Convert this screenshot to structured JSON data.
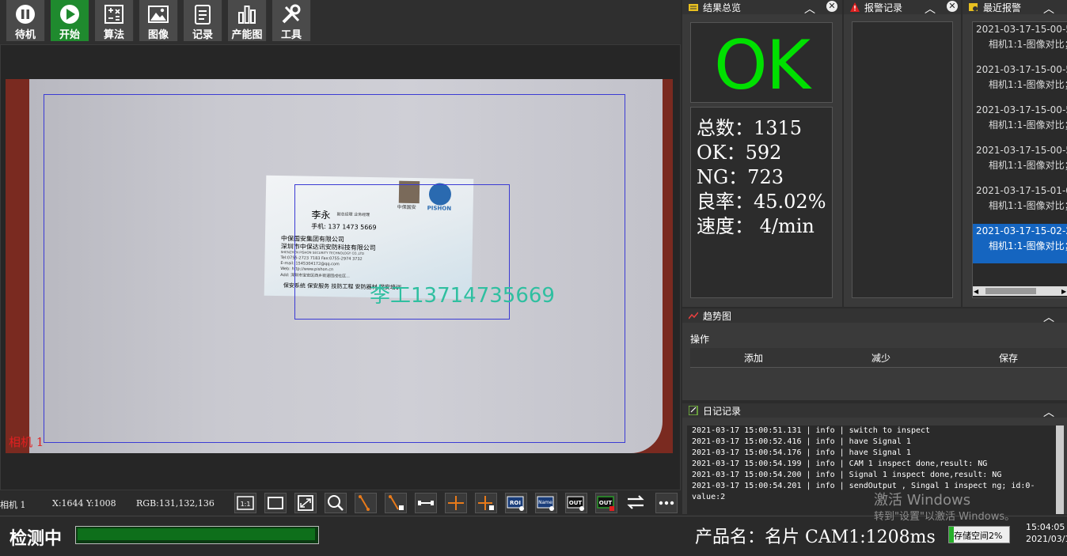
{
  "toolbar": {
    "items": [
      {
        "label": "待机",
        "icon": "pause-icon"
      },
      {
        "label": "开始",
        "icon": "play-icon"
      },
      {
        "label": "算法",
        "icon": "algorithm-icon"
      },
      {
        "label": "图像",
        "icon": "image-icon"
      },
      {
        "label": "记录",
        "icon": "record-icon"
      },
      {
        "label": "产能图",
        "icon": "bar-chart-icon"
      },
      {
        "label": "工具",
        "icon": "tools-icon"
      }
    ]
  },
  "camera_view": {
    "camera_label": "相机 1",
    "overlay_text": "李工13714735669",
    "card": {
      "name": "李永",
      "title": "副总经理 业务经理",
      "mobile": "手机: 137 1473 5669",
      "company_cn1": "中保国安集团有限公司",
      "company_cn2": "深圳市中保达讯安防科技有限公司",
      "company_en": "SHENZHEN PISHON SECURITY TECHNOLOGY CO.,LTD",
      "tel": "Tel:0755-2723 7183    Fax:0755-2974 3732",
      "email": "E-mail: 1545304172@qq.com",
      "web": "Web: http://www.pishon.cn",
      "add": "Add: 深圳市宝安区西乡街道固戍社区...",
      "services": "保安系统   保安服务   技防工程   安防器材   保安培训",
      "logo1": "中保国安",
      "logo2": "PISHON"
    }
  },
  "status": {
    "camera": "相机 1",
    "coords": "X:1644 Y:1008",
    "rgb": "RGB:131,132,136"
  },
  "image_tools": [
    "fit-1to1-icon",
    "fit-window-icon",
    "fit-full-icon",
    "zoom-icon",
    "point-add-icon",
    "point-delete-icon",
    "line-measure-icon",
    "cross-add-icon",
    "cross-delete-icon",
    "roi-icon",
    "name-icon",
    "out-view-icon",
    "out-set-icon",
    "swap-icon",
    "more-icon"
  ],
  "image_tool_labels": {
    "t11": "1:1",
    "roi": "ROI",
    "name": "Name",
    "out1": "OUT",
    "out2": "OUT"
  },
  "result_panel": {
    "title": "结果总览",
    "result": "OK",
    "result_color": "#00e000",
    "total": "总数：1315",
    "ok": "OK：592",
    "ng": "NG：723",
    "yield": "良率：45.02%",
    "speed": "速度：  4/min"
  },
  "alarm_panel": {
    "title": "报警记录"
  },
  "recent_panel": {
    "title": "最近报警",
    "items": [
      {
        "time": "2021-03-17-15-00-5",
        "desc": "相机1:1-图像对比；"
      },
      {
        "time": "2021-03-17-15-00-5",
        "desc": "相机1:1-图像对比；"
      },
      {
        "time": "2021-03-17-15-00-5",
        "desc": "相机1:1-图像对比；"
      },
      {
        "time": "2021-03-17-15-00-5",
        "desc": "相机1:1-图像对比；"
      },
      {
        "time": "2021-03-17-15-01-0",
        "desc": "相机1:1-图像对比；"
      },
      {
        "time": "2021-03-17-15-02-2",
        "desc": "相机1:1-图像对比；"
      }
    ]
  },
  "trend_panel": {
    "title": "趋势图",
    "op_label": "操作",
    "add": "添加",
    "reduce": "减少",
    "save": "保存"
  },
  "log_panel": {
    "title": "日记记录",
    "lines": [
      "2021-03-17 15:00:51.131 | info | switch to inspect",
      "2021-03-17 15:00:52.416 | info | have Signal 1",
      "2021-03-17 15:00:54.176 | info | have Signal 1",
      "2021-03-17 15:00:54.199 | info | CAM 1 inspect done,result: NG",
      "2021-03-17 15:00:54.200 | info | Signal 1 inspect done,result: NG",
      "2021-03-17 15:00:54.201 | info | sendOutput , Singal 1 inspect ng; id:0-",
      "value:2"
    ]
  },
  "bottom": {
    "detect_label": "检测中",
    "product": "产品名：名片  CAM1:1208ms",
    "storage": "存储空间2%",
    "storage_pct": 0.02,
    "clock_time": "15:04:05",
    "clock_date": "2021/03/1",
    "watermark1": "激活 Windows",
    "watermark2": "转到\"设置\"以激活 Windows。"
  }
}
